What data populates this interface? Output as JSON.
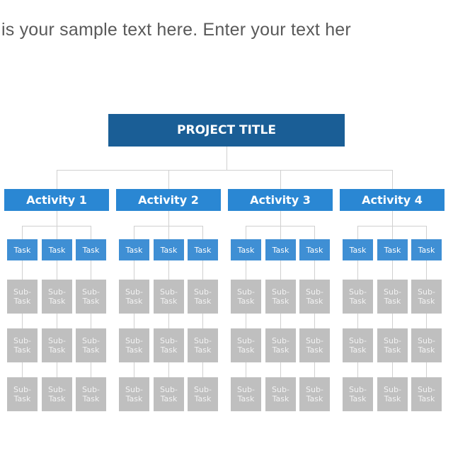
{
  "headline": "is your sample text here. Enter your text her",
  "colors": {
    "title": "#1a5e96",
    "activity": "#2a87d3",
    "task": "#3f8fd4",
    "subtask": "#bfbfbf",
    "connector": "#d0d0d0",
    "text": "#595959"
  },
  "project_title": "PROJECT TITLE",
  "activities": [
    {
      "label": "Activity 1",
      "tasks": [
        {
          "label": "Task",
          "subtasks": [
            "Sub-Task",
            "Sub-Task",
            "Sub-Task"
          ]
        },
        {
          "label": "Task",
          "subtasks": [
            "Sub-Task",
            "Sub-Task",
            "Sub-Task"
          ]
        },
        {
          "label": "Task",
          "subtasks": [
            "Sub-Task",
            "Sub-Task",
            "Sub-Task"
          ]
        }
      ]
    },
    {
      "label": "Activity 2",
      "tasks": [
        {
          "label": "Task",
          "subtasks": [
            "Sub-Task",
            "Sub-Task",
            "Sub-Task"
          ]
        },
        {
          "label": "Task",
          "subtasks": [
            "Sub-Task",
            "Sub-Task",
            "Sub-Task"
          ]
        },
        {
          "label": "Task",
          "subtasks": [
            "Sub-Task",
            "Sub-Task",
            "Sub-Task"
          ]
        }
      ]
    },
    {
      "label": "Activity 3",
      "tasks": [
        {
          "label": "Task",
          "subtasks": [
            "Sub-Task",
            "Sub-Task",
            "Sub-Task"
          ]
        },
        {
          "label": "Task",
          "subtasks": [
            "Sub-Task",
            "Sub-Task",
            "Sub-Task"
          ]
        },
        {
          "label": "Task",
          "subtasks": [
            "Sub-Task",
            "Sub-Task",
            "Sub-Task"
          ]
        }
      ]
    },
    {
      "label": "Activity 4",
      "tasks": [
        {
          "label": "Task",
          "subtasks": [
            "Sub-Task",
            "Sub-Task",
            "Sub-Task"
          ]
        },
        {
          "label": "Task",
          "subtasks": [
            "Sub-Task",
            "Sub-Task",
            "Sub-Task"
          ]
        },
        {
          "label": "Task",
          "subtasks": [
            "Sub-Task",
            "Sub-Task",
            "Sub-Task"
          ]
        }
      ]
    }
  ]
}
